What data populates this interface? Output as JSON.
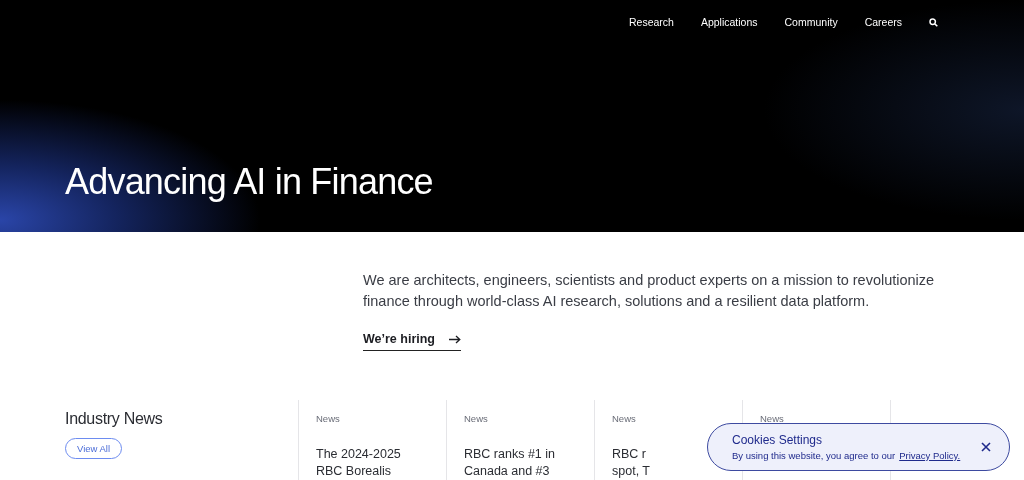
{
  "nav": {
    "items": [
      "Research",
      "Applications",
      "Community",
      "Careers"
    ]
  },
  "hero": {
    "title": "Advancing AI in Finance"
  },
  "intro": {
    "text": "We are architects, engineers, scientists and product experts on a mission to revolutionize finance through world-class AI research, solutions and a resilient data platform.",
    "link": "We’re hiring"
  },
  "news": {
    "heading": "Industry News",
    "button": "View All",
    "cards": [
      {
        "category": "News",
        "title_lines": [
          "The 2024-2025",
          "RBC Borealis"
        ]
      },
      {
        "category": "News",
        "title_lines": [
          "RBC ranks #1 in",
          "Canada and #3"
        ]
      },
      {
        "category": "News",
        "title_lines": [
          "RBC r",
          "spot, T"
        ]
      },
      {
        "category": "News"
      }
    ]
  },
  "cookie_banner": {
    "title": "Cookies Settings",
    "text": "By using this website, you agree to our",
    "link": "Privacy Policy."
  }
}
